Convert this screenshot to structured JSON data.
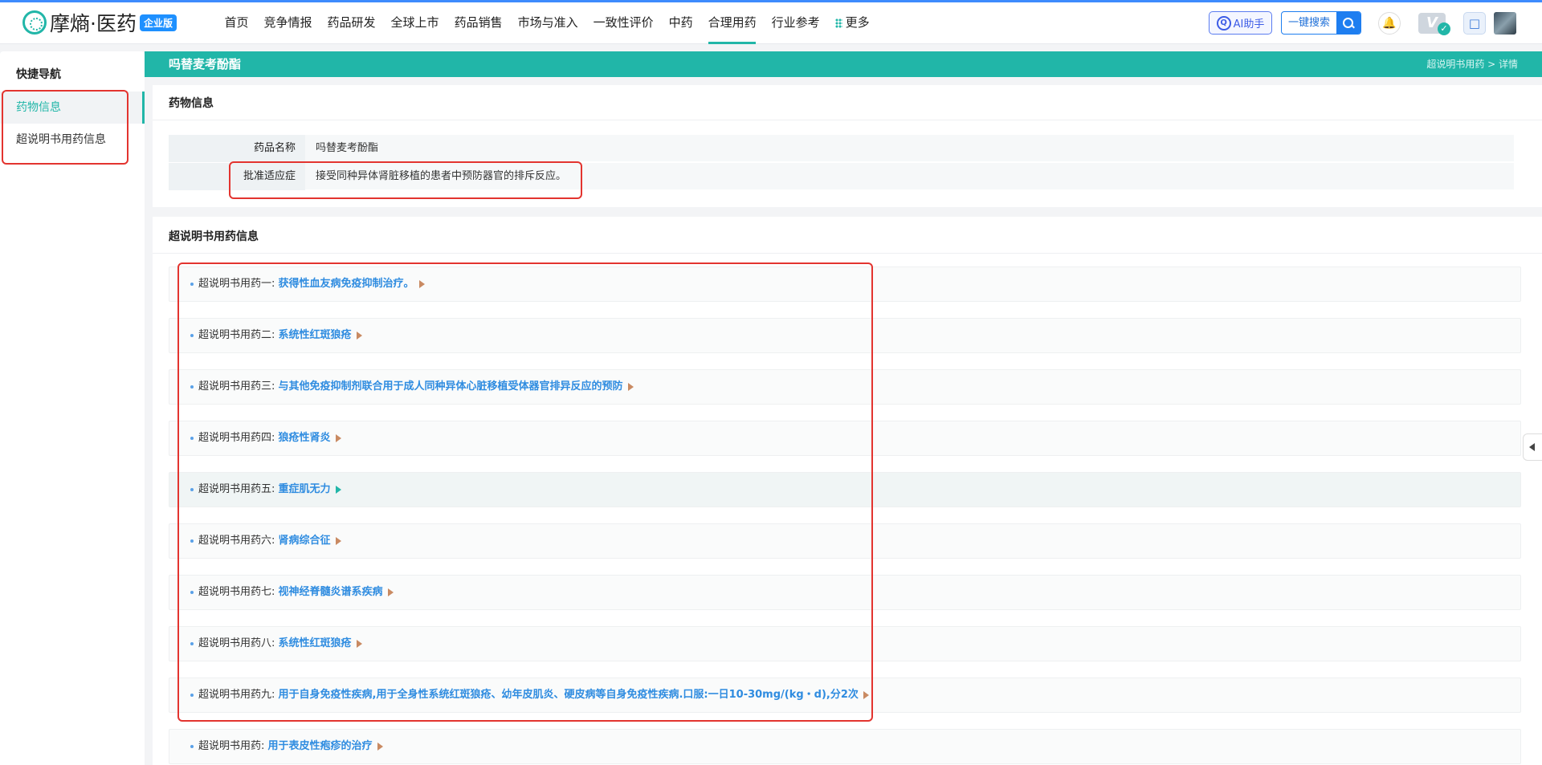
{
  "header": {
    "logo_text": "摩熵·医药",
    "logo_badge": "企业版",
    "nav": [
      "首页",
      "竞争情报",
      "药品研发",
      "全球上市",
      "药品销售",
      "市场与准入",
      "一致性评价",
      "中药",
      "合理用药",
      "行业参考",
      "更多"
    ],
    "active_nav": "合理用药",
    "ai_label": "AI助手",
    "search_label": "一键搜索",
    "vip_label": "V"
  },
  "sidebar": {
    "title": "快捷导航",
    "items": [
      "药物信息",
      "超说明书用药信息"
    ]
  },
  "banner": {
    "title": "吗替麦考酚酯",
    "breadcrumb": "超说明书用药 > 详情"
  },
  "drug_info": {
    "title": "药物信息",
    "rows": [
      {
        "label": "药品名称",
        "value": "吗替麦考酚酯"
      },
      {
        "label": "批准适应症",
        "value": "接受同种异体肾脏移植的患者中预防器官的排斥反应。"
      }
    ]
  },
  "off_label": {
    "title": "超说明书用药信息",
    "items": [
      {
        "label": "超说明书用药一:",
        "value": "获得性血友病免疫抑制治疗。"
      },
      {
        "label": "超说明书用药二:",
        "value": "系统性红斑狼疮"
      },
      {
        "label": "超说明书用药三:",
        "value": "与其他免疫抑制剂联合用于成人同种异体心脏移植受体器官排异反应的预防"
      },
      {
        "label": "超说明书用药四:",
        "value": "狼疮性肾炎"
      },
      {
        "label": "超说明书用药五:",
        "value": "重症肌无力"
      },
      {
        "label": "超说明书用药六:",
        "value": "肾病综合征"
      },
      {
        "label": "超说明书用药七:",
        "value": "视神经脊髓炎谱系疾病"
      },
      {
        "label": "超说明书用药八:",
        "value": "系统性红斑狼疮"
      },
      {
        "label": "超说明书用药九:",
        "value": "用于自身免疫性疾病,用于全身性系统红斑狼疮、幼年皮肌炎、硬皮病等自身免疫性疾病.口服:一日10-30mg/(kg・d),分2次"
      },
      {
        "label": "超说明书用药:",
        "value": "用于表皮性疱疹的治疗"
      }
    ],
    "highlight_index": 4
  },
  "colors": {
    "accent": "#21b6a8",
    "link": "#2f8ce0",
    "highlight_box": "#e3342f"
  }
}
